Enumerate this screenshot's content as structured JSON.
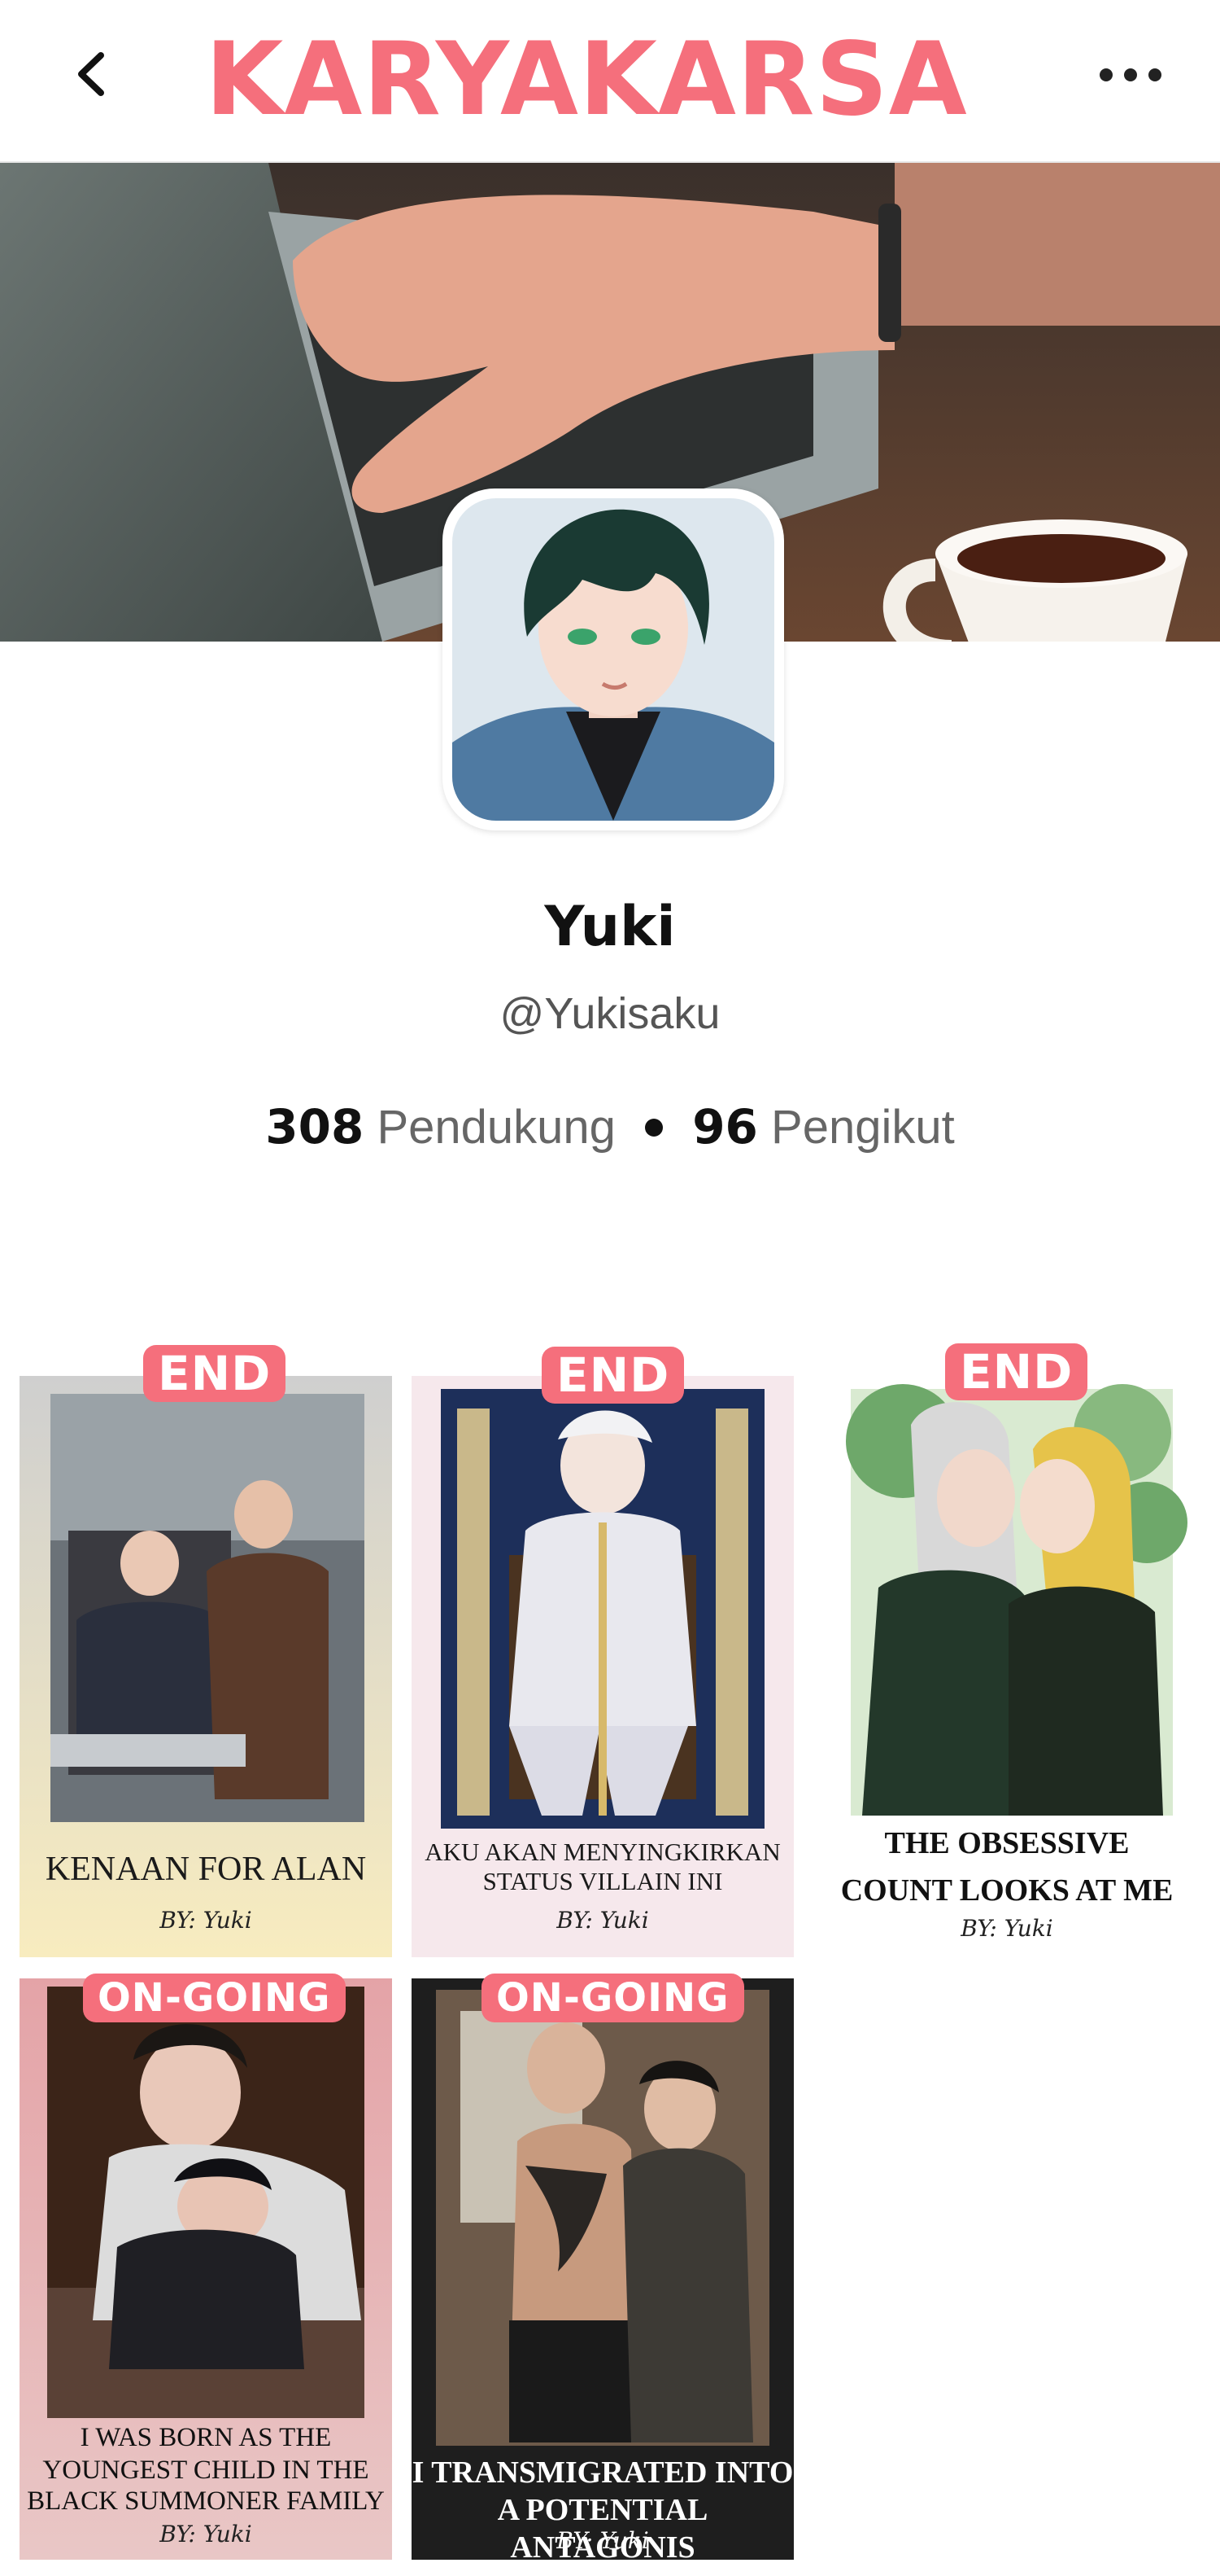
{
  "header": {
    "brand": "KARYAKARSA",
    "back_icon": "chevron-left-icon",
    "more_icon": "more-horizontal-icon",
    "brand_color": "#f56f7c"
  },
  "profile": {
    "name": "Yuki",
    "handle": "@Yukisaku",
    "supporters_count": "308",
    "supporters_label": "Pendukung",
    "followers_count": "96",
    "followers_label": "Pengikut"
  },
  "works": [
    {
      "status": "END",
      "title": "KENAAN FOR ALAN",
      "byline": "BY: Yuki"
    },
    {
      "status": "END",
      "title_line1": "AKU AKAN MENYINGKIRKAN",
      "title_line2": "STATUS VILLAIN INI",
      "byline": "BY: Yuki"
    },
    {
      "status": "END",
      "title_line1": "THE OBSESSIVE",
      "title_line2": "COUNT LOOKS AT ME",
      "byline": "BY: Yuki"
    },
    {
      "status": "ON-GOING",
      "title_line1": "I WAS BORN AS THE",
      "title_line2": "YOUNGEST CHILD IN THE",
      "title_line3": "BLACK SUMMONER FAMILY",
      "byline": "BY: Yuki"
    },
    {
      "status": "ON-GOING",
      "title_line1": "I TRANSMIGRATED INTO",
      "title_line2": "A POTENTIAL ANTAGONIS",
      "byline": "BY: Yuki"
    }
  ]
}
